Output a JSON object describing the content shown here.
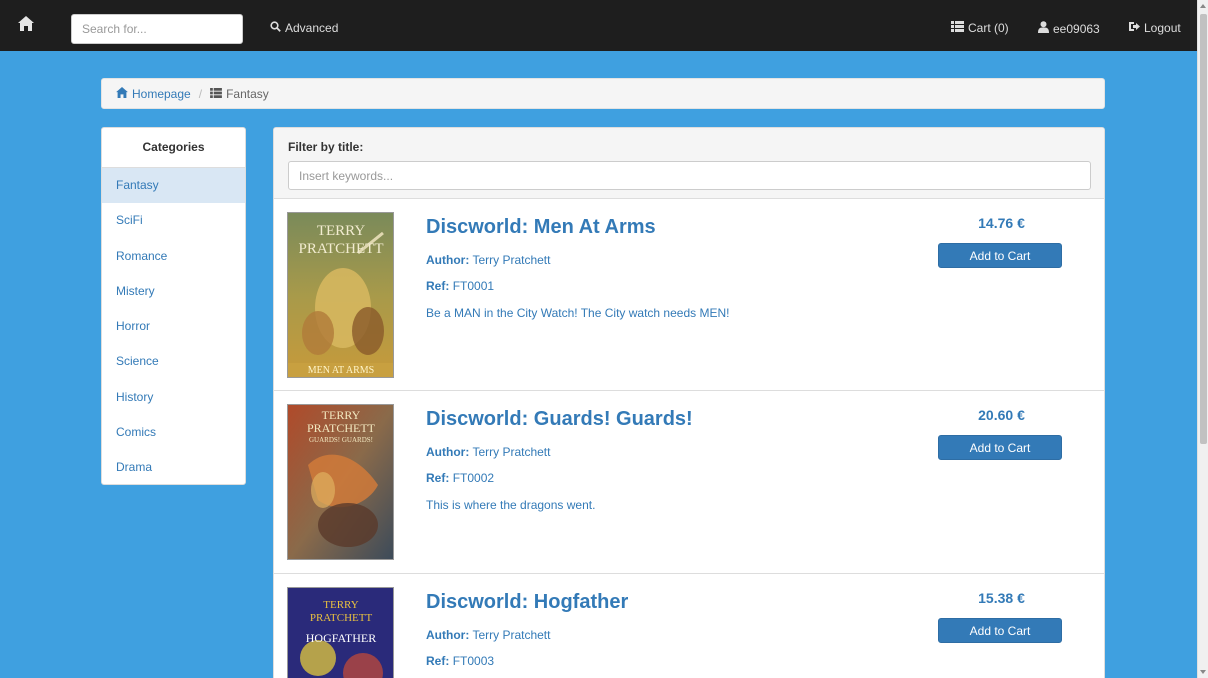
{
  "navbar": {
    "search_placeholder": "Search for...",
    "advanced_label": "Advanced",
    "cart_label": "Cart (0)",
    "user_label": "ee09063",
    "logout_label": "Logout"
  },
  "breadcrumb": {
    "home_label": "Homepage",
    "current_label": "Fantasy"
  },
  "sidebar": {
    "title": "Categories",
    "items": [
      "Fantasy",
      "SciFi",
      "Romance",
      "Mistery",
      "Horror",
      "Science",
      "History",
      "Comics",
      "Drama"
    ],
    "active": "Fantasy"
  },
  "filter": {
    "label": "Filter by title:",
    "placeholder": "Insert keywords..."
  },
  "labels": {
    "author": "Author:",
    "ref": "Ref:",
    "add_to_cart": "Add to Cart"
  },
  "books": [
    {
      "title": "Discworld: Men At Arms",
      "author": "Terry Pratchett",
      "ref": "FT0001",
      "description": "Be a MAN in the City Watch! The City watch needs MEN!",
      "price": "14.76 €",
      "cover_lines": [
        "TERRY",
        "PRATCHETT",
        "MEN AT ARMS"
      ]
    },
    {
      "title": "Discworld: Guards! Guards!",
      "author": "Terry Pratchett",
      "ref": "FT0002",
      "description": "This is where the dragons went.",
      "price": "20.60 €",
      "cover_lines": [
        "TERRY",
        "PRATCHETT",
        "GUARDS! GUARDS!"
      ]
    },
    {
      "title": "Discworld: Hogfather",
      "author": "Terry Pratchett",
      "ref": "FT0003",
      "description": "",
      "price": "15.38 €",
      "cover_lines": [
        "TERRY",
        "PRATCHETT",
        "HOGFATHER"
      ]
    }
  ],
  "colors": {
    "page_bg": "#3fa0e0",
    "navbar_bg": "#1e1e1e",
    "link": "#337ab7",
    "button": "#337ab7"
  },
  "icons": {
    "home": "home-icon",
    "search": "search-icon",
    "cart": "list-icon",
    "user": "user-icon",
    "logout": "logout-icon"
  }
}
